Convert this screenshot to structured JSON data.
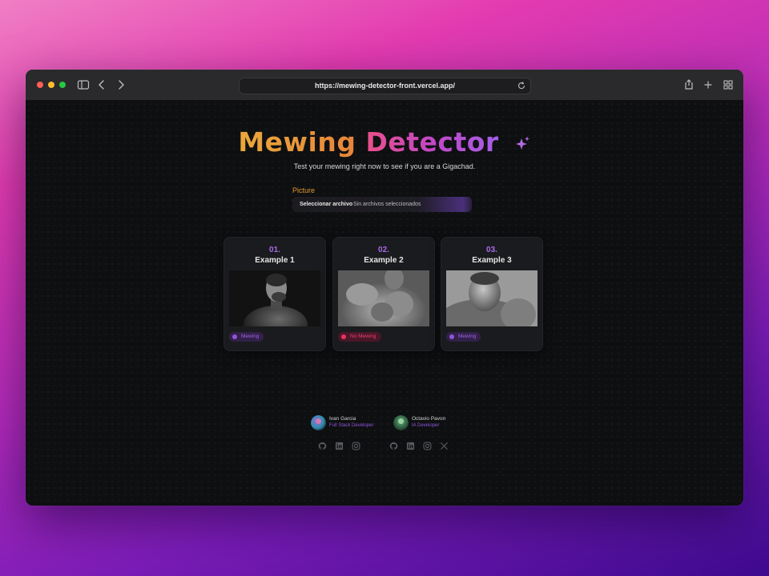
{
  "browser": {
    "url": "https://mewing-detector-front.vercel.app/"
  },
  "page": {
    "title_part1": "Mewing",
    "title_part2": "Detector",
    "subtitle": "Test your mewing right now to see if you are a Gigachad.",
    "picture_label": "Picture",
    "file_button": "Seleccionar archivo",
    "file_status": "Sin archivos seleccionados"
  },
  "examples": [
    {
      "number": "01.",
      "name": "Example 1",
      "badge": "Mewing"
    },
    {
      "number": "02.",
      "name": "Example 2",
      "badge": "No Mewing"
    },
    {
      "number": "03.",
      "name": "Example 3",
      "badge": "Mewing"
    }
  ],
  "developers": [
    {
      "name": "Ivan Garcia",
      "role": "Full Stack Developer"
    },
    {
      "name": "Octavio Pavon",
      "role": "IA Developer"
    }
  ],
  "colors": {
    "accent_purple": "#8f55d8",
    "accent_orange": "#e29a2f",
    "negative_red": "#e8315f"
  },
  "icons": {
    "sparkle": "sparkle-icon",
    "github": "github-icon",
    "linkedin": "linkedin-icon",
    "instagram": "instagram-icon",
    "x": "x-icon"
  }
}
